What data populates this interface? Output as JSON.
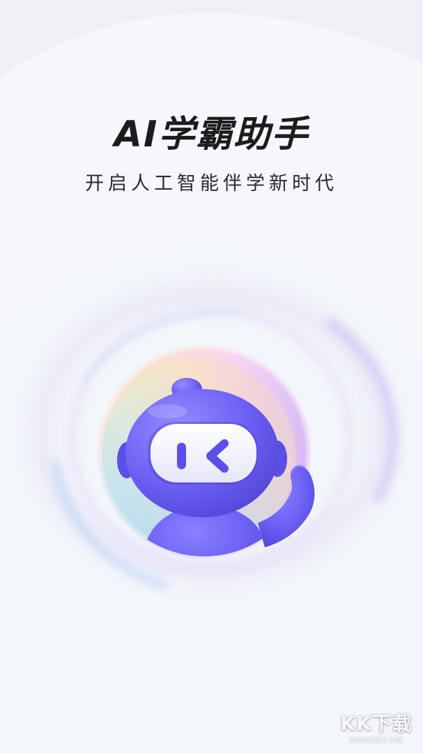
{
  "hero": {
    "title": "AI学霸助手",
    "subtitle": "开启人工智能伴学新时代"
  },
  "mascot": {
    "icon": "robot-mascot-icon",
    "accent": "#6c5ff0"
  },
  "watermark": {
    "logo_text": "KK下载",
    "site_text": "www.kkx.net"
  },
  "colors": {
    "background": "#f4f6fb",
    "title": "#1c1c1f",
    "robot_body": "#6a5ef2",
    "robot_visor": "#ffffff"
  }
}
